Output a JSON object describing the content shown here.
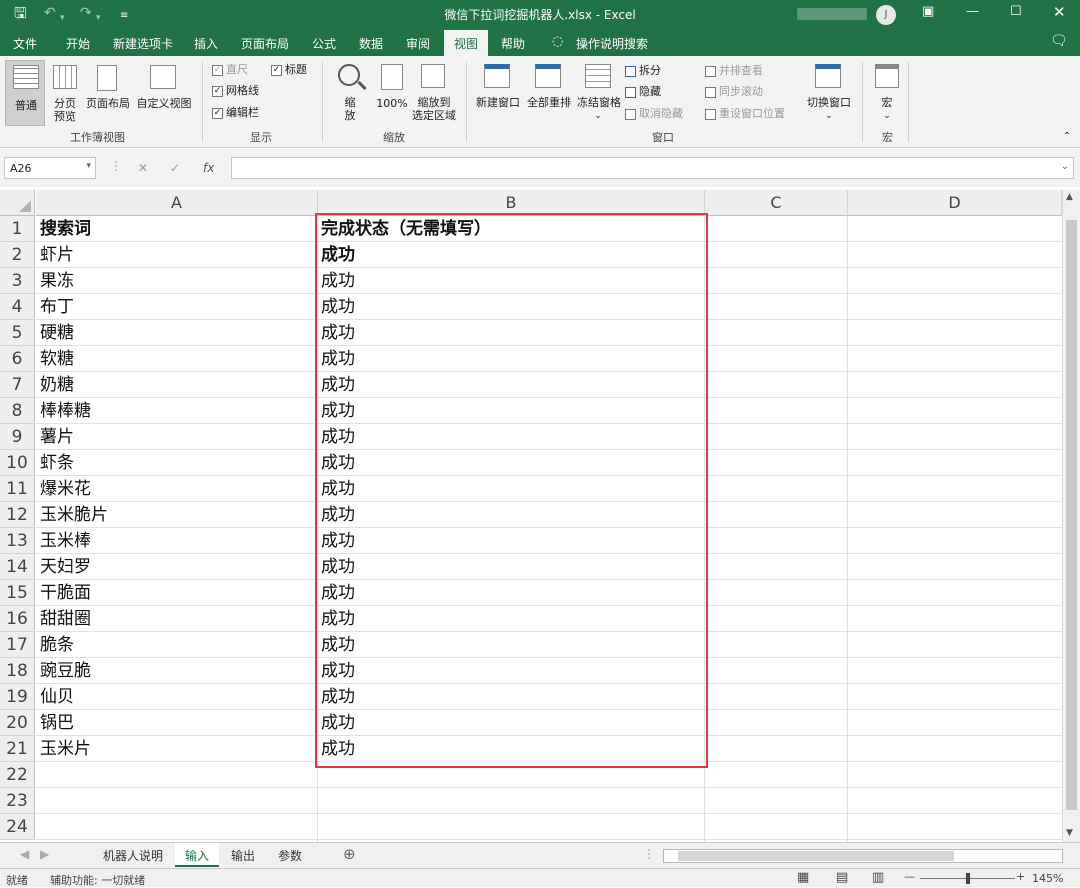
{
  "window": {
    "title": "微信下拉词挖掘机器人.xlsx  -  Excel",
    "user_initial": "J",
    "save_icon": "save-icon",
    "accent": "#217346",
    "highlight": "#e0393e"
  },
  "menu": [
    "文件",
    "开始",
    "新建选项卡",
    "插入",
    "页面布局",
    "公式",
    "数据",
    "审阅",
    "视图",
    "帮助",
    "操作说明搜索"
  ],
  "ribbon": {
    "normal": "普通",
    "page_break_1": "分页",
    "page_break_2": "预览",
    "page_layout": "页面布局",
    "custom_view": "自定义视图",
    "group_workbook_views": "工作簿视图",
    "ruler": "直尺",
    "gridlines": "网格线",
    "formula_bar": "编辑栏",
    "headings": "标题",
    "group_show": "显示",
    "zoom_1": "缩",
    "zoom_2": "放",
    "zoom_100": "100%",
    "zoom_sel_1": "缩放到",
    "zoom_sel_2": "选定区域",
    "group_zoom": "缩放",
    "new_window": "新建窗口",
    "arrange_all": "全部重排",
    "freeze": "冻结窗格",
    "split": "拆分",
    "hide": "隐藏",
    "unhide": "取消隐藏",
    "side_by_side": "并排查看",
    "sync_scroll": "同步滚动",
    "reset_pos": "重设窗口位置",
    "switch_window": "切换窗口",
    "group_window": "窗口",
    "macro": "宏",
    "group_macro": "宏"
  },
  "formula_bar": {
    "name_box": "A26",
    "cancel": "✕",
    "enter": "✓",
    "fx": "fx",
    "value": ""
  },
  "columns": [
    "A",
    "B",
    "C",
    "D"
  ],
  "rows": [
    {
      "n": "1",
      "a": "搜索词",
      "b": "完成状态（无需填写）"
    },
    {
      "n": "2",
      "a": "虾片",
      "b": "成功"
    },
    {
      "n": "3",
      "a": "果冻",
      "b": "成功"
    },
    {
      "n": "4",
      "a": "布丁",
      "b": "成功"
    },
    {
      "n": "5",
      "a": "硬糖",
      "b": "成功"
    },
    {
      "n": "6",
      "a": "软糖",
      "b": "成功"
    },
    {
      "n": "7",
      "a": "奶糖",
      "b": "成功"
    },
    {
      "n": "8",
      "a": "棒棒糖",
      "b": "成功"
    },
    {
      "n": "9",
      "a": "薯片",
      "b": "成功"
    },
    {
      "n": "10",
      "a": "虾条",
      "b": "成功"
    },
    {
      "n": "11",
      "a": "爆米花",
      "b": "成功"
    },
    {
      "n": "12",
      "a": "玉米脆片",
      "b": "成功"
    },
    {
      "n": "13",
      "a": "玉米棒",
      "b": "成功"
    },
    {
      "n": "14",
      "a": "天妇罗",
      "b": "成功"
    },
    {
      "n": "15",
      "a": "干脆面",
      "b": "成功"
    },
    {
      "n": "16",
      "a": "甜甜圈",
      "b": "成功"
    },
    {
      "n": "17",
      "a": "脆条",
      "b": "成功"
    },
    {
      "n": "18",
      "a": "豌豆脆",
      "b": "成功"
    },
    {
      "n": "19",
      "a": "仙贝",
      "b": "成功"
    },
    {
      "n": "20",
      "a": "锅巴",
      "b": "成功"
    },
    {
      "n": "21",
      "a": "玉米片",
      "b": "成功"
    },
    {
      "n": "22",
      "a": "",
      "b": ""
    },
    {
      "n": "23",
      "a": "",
      "b": ""
    },
    {
      "n": "24",
      "a": "",
      "b": ""
    }
  ],
  "sheet_tabs": [
    "机器人说明",
    "输入",
    "输出",
    "参数"
  ],
  "status": {
    "ready": "就绪",
    "accessibility": "辅助功能: 一切就绪",
    "zoom": "145%"
  }
}
